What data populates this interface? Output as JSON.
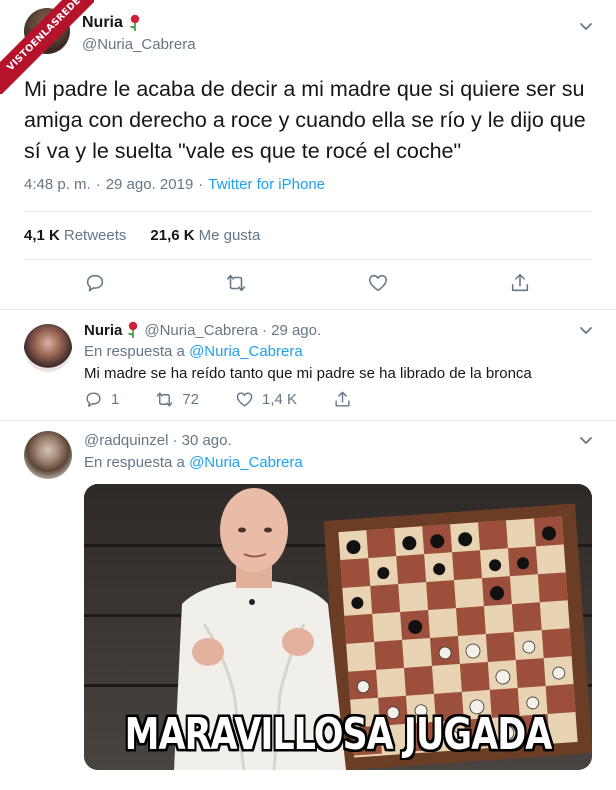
{
  "watermark": {
    "text": "VISTOENLASREDES"
  },
  "tweet": {
    "author_name": "Nuria",
    "author_handle": "@Nuria_Cabrera",
    "text": "Mi padre le acaba de decir a mi madre que si quiere ser su amiga con derecho a roce y cuando ella se río y le dijo que sí va y le suelta \"vale es que te rocé el coche\"",
    "time": "4:48 p. m.",
    "sep1": "·",
    "date": "29 ago. 2019",
    "sep2": "·",
    "source": "Twitter for iPhone",
    "retweets_count": "4,1 K",
    "retweets_label": "Retweets",
    "likes_count": "21,6 K",
    "likes_label": "Me gusta"
  },
  "replies": [
    {
      "author_name": "Nuria",
      "author_handle": "@Nuria_Cabrera",
      "date": "· 29 ago.",
      "reply_prefix": "En respuesta a",
      "reply_to": "@Nuria_Cabrera",
      "text": "Mi madre se ha reído tanto que mi padre se ha librado de la bronca",
      "reply_count": "1",
      "retweet_count": "72",
      "like_count": "1,4 K"
    },
    {
      "author_handle": "@radquinzel",
      "date": "· 30 ago.",
      "reply_prefix": "En respuesta a",
      "reply_to": "@Nuria_Cabrera",
      "media_caption": "MARAVILLOSA JUGADA"
    }
  ],
  "icons": [
    "rose-icon",
    "chevron-down-icon",
    "reply-icon",
    "retweet-icon",
    "heart-icon",
    "share-icon"
  ],
  "colors": {
    "link": "#1da1f2",
    "secondary": "#657786",
    "text": "#14171a",
    "badge": "#b5122b"
  }
}
